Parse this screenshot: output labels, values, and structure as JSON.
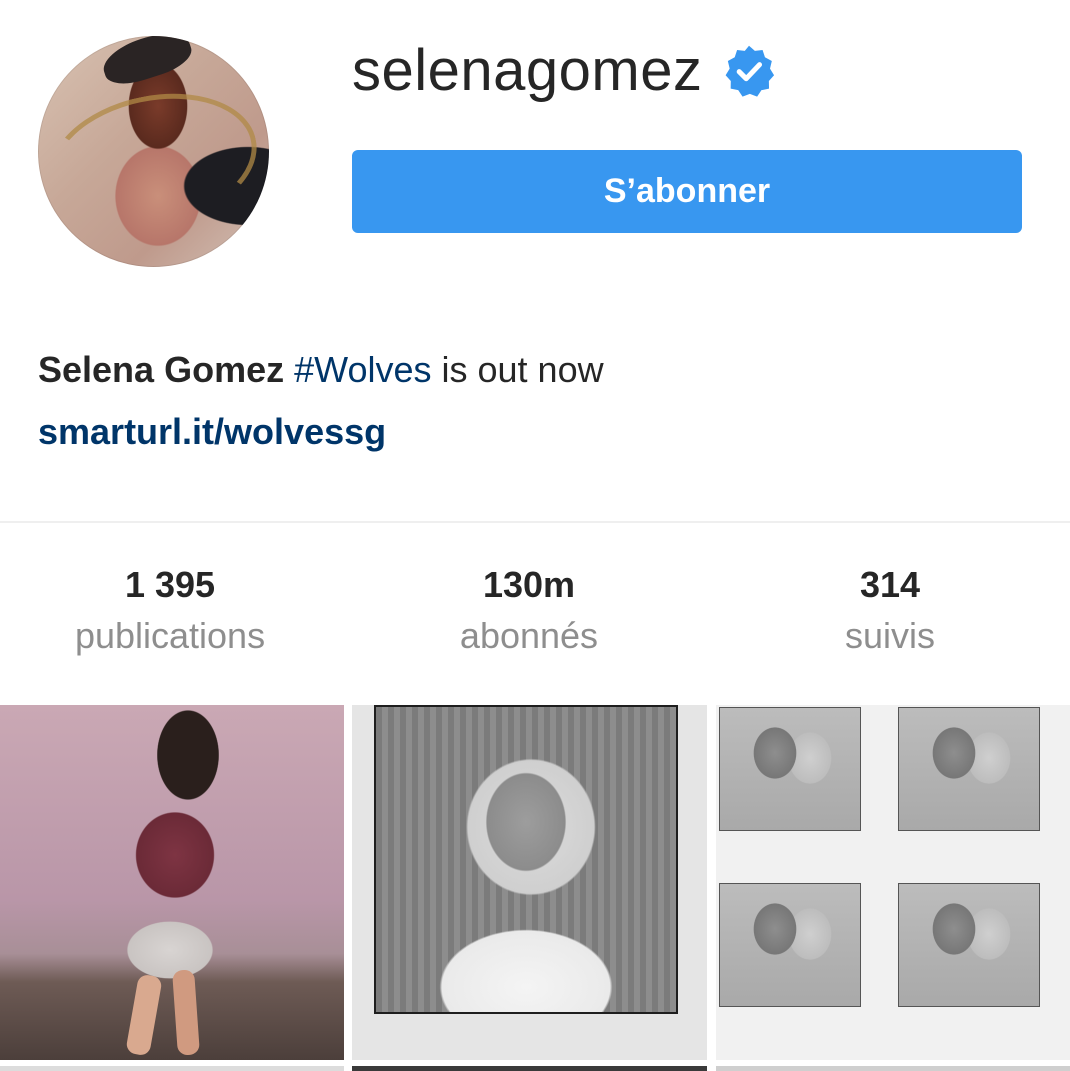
{
  "profile": {
    "username": "selenagomez",
    "verified": true,
    "follow_label": "S’abonner",
    "avatar_icon": "avatar-photo",
    "accent_color": "#3897f0"
  },
  "bio": {
    "name": "Selena Gomez",
    "hashtag": "#Wolves",
    "text": " is out now",
    "link": "smarturl.it/wolvessg"
  },
  "stats": [
    {
      "count": "1 395",
      "label": "publications"
    },
    {
      "count": "130m",
      "label": "abonnés"
    },
    {
      "count": "314",
      "label": "suivis"
    }
  ],
  "posts": [
    {
      "icon": "post-photo"
    },
    {
      "icon": "post-photo"
    },
    {
      "icon": "post-photo"
    }
  ]
}
